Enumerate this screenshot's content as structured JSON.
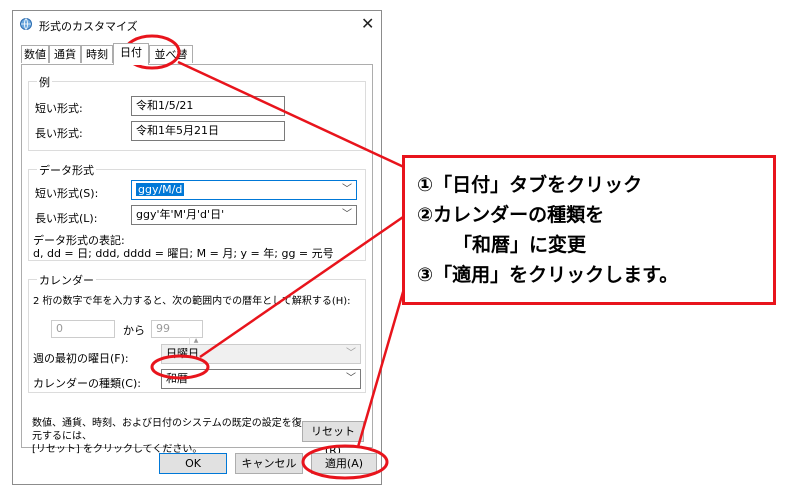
{
  "dialog": {
    "title": "形式のカスタマイズ",
    "close_glyph": "✕",
    "tabs": [
      "数値",
      "通貨",
      "時刻",
      "日付",
      "並べ替え"
    ],
    "active_tab": "日付"
  },
  "example": {
    "group_title": "例",
    "short_label": "短い形式:",
    "short_value": "令和1/5/21",
    "long_label": "長い形式:",
    "long_value": "令和1年5月21日"
  },
  "data_format": {
    "group_title": "データ形式",
    "short_label": "短い形式(S):",
    "short_value": "ggy/M/d",
    "long_label": "長い形式(L):",
    "long_value": "ggy'年'M'月'd'日'",
    "notation_title": "データ形式の表記:",
    "notation_text": "d, dd = 日; ddd, dddd = 曜日; M = 月; y = 年; gg = 元号"
  },
  "calendar": {
    "group_title": "カレンダー",
    "two_digit_text": "2 桁の数字で年を入力すると、次の範囲内での暦年として解釈する(H):",
    "from_value": "0",
    "range_sep": "から",
    "to_value": "99",
    "first_day_label": "週の最初の曜日(F):",
    "first_day_value": "日曜日",
    "type_label": "カレンダーの種類(C):",
    "type_value": "和暦"
  },
  "footer": {
    "reset_text_line1": "数値、通貨、時刻、および日付のシステムの既定の設定を復元するには、",
    "reset_text_line2": "[リセット] をクリックしてください。",
    "reset_button": "リセット(R)",
    "ok_button": "OK",
    "cancel_button": "キャンセル",
    "apply_button": "適用(A)"
  },
  "annotation": {
    "line1": "①「日付」タブをクリック",
    "line2": "②カレンダーの種類を",
    "line3": "「和暦」に変更",
    "line4": "③「適用」をクリックします。",
    "color": "#e8141c"
  }
}
